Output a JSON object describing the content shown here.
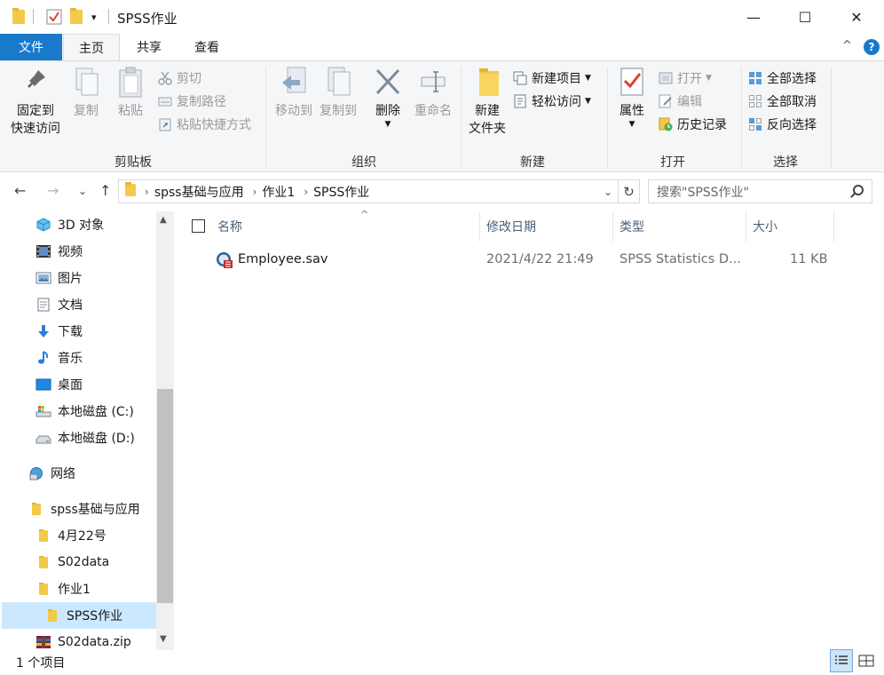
{
  "window": {
    "title": "SPSS作业",
    "minimize": "—",
    "maximize": "☐",
    "close": "✕",
    "dropdown": "▾"
  },
  "tabs": {
    "file": "文件",
    "home": "主页",
    "share": "共享",
    "view": "查看",
    "collapse": "^",
    "help": "?"
  },
  "ribbon": {
    "clipboard": {
      "pin": "固定到\n快速访问",
      "pin_l1": "固定到",
      "pin_l2": "快速访问",
      "copy": "复制",
      "paste": "粘贴",
      "cut": "剪切",
      "copy_path": "复制路径",
      "paste_shortcut": "粘贴快捷方式",
      "label": "剪贴板"
    },
    "organize": {
      "move_to": "移动到",
      "copy_to": "复制到",
      "delete": "删除",
      "rename": "重命名",
      "label": "组织"
    },
    "new": {
      "new_folder_l1": "新建",
      "new_folder_l2": "文件夹",
      "new_item": "新建项目",
      "easy_access": "轻松访问",
      "label": "新建"
    },
    "open": {
      "properties": "属性",
      "open": "打开",
      "edit": "编辑",
      "history": "历史记录",
      "label": "打开"
    },
    "select": {
      "select_all": "全部选择",
      "select_none": "全部取消",
      "invert": "反向选择",
      "label": "选择"
    }
  },
  "address": {
    "crumbs": [
      "spss基础与应用",
      "作业1",
      "SPSS作业"
    ],
    "search_placeholder": "搜索\"SPSS作业\""
  },
  "nav": [
    {
      "label": "3D 对象",
      "icon": "3d-objects-icon"
    },
    {
      "label": "视频",
      "icon": "video-icon"
    },
    {
      "label": "图片",
      "icon": "pictures-icon"
    },
    {
      "label": "文档",
      "icon": "documents-icon"
    },
    {
      "label": "下载",
      "icon": "download-icon"
    },
    {
      "label": "音乐",
      "icon": "music-icon"
    },
    {
      "label": "桌面",
      "icon": "desktop-icon"
    },
    {
      "label": "本地磁盘 (C:)",
      "icon": "drive-c-icon"
    },
    {
      "label": "本地磁盘 (D:)",
      "icon": "drive-d-icon"
    },
    {
      "label": "网络",
      "icon": "network-icon"
    },
    {
      "label": "spss基础与应用",
      "icon": "folder-icon"
    },
    {
      "label": "4月22号",
      "icon": "folder-icon"
    },
    {
      "label": "S02data",
      "icon": "folder-icon"
    },
    {
      "label": "作业1",
      "icon": "folder-icon"
    },
    {
      "label": "SPSS作业",
      "icon": "folder-icon"
    },
    {
      "label": "S02data.zip",
      "icon": "zip-archive-icon"
    }
  ],
  "columns": {
    "name": "名称",
    "modified": "修改日期",
    "type": "类型",
    "size": "大小"
  },
  "files": [
    {
      "name": "Employee.sav",
      "modified": "2021/4/22 21:49",
      "type": "SPSS Statistics D...",
      "size": "11 KB"
    }
  ],
  "status": {
    "count": "1 个项目"
  },
  "colors": {
    "accent": "#1979ca",
    "selection": "#cce8ff",
    "folder": "#f3c94a",
    "ribbon_bg": "#f5f6f7"
  }
}
